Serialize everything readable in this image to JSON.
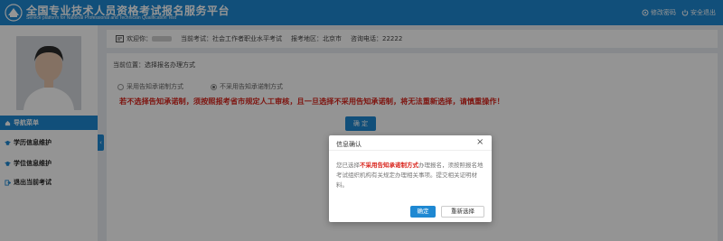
{
  "header": {
    "title": "全国专业技术人员资格考试报名服务平台",
    "subtitle": "Service platform for National Professional and Technician Qualification Test",
    "links": [
      {
        "label": "修改密码",
        "icon": "settings-icon"
      },
      {
        "label": "安全退出",
        "icon": "power-icon"
      }
    ]
  },
  "sidebar": {
    "nav_header": {
      "label": "导航菜单",
      "icon": "home-icon"
    },
    "items": [
      {
        "label": "学历信息维护",
        "icon": "graduation-cap-icon"
      },
      {
        "label": "学位信息维护",
        "icon": "graduation-cap-icon"
      },
      {
        "label": "退出当前考试",
        "icon": "logout-icon"
      }
    ],
    "collapse_glyph": "‹"
  },
  "infobar": {
    "welcome_label": "欢迎你：",
    "current_exam_label": "当前考试：",
    "current_exam_value": "社会工作者职业水平考试",
    "region_label": "报考地区：",
    "region_value": "北京市",
    "phone_label": "咨询电话：",
    "phone_value": "22222"
  },
  "main": {
    "breadcrumb": "当前位置：选择报名办理方式",
    "options": [
      {
        "label": "采用告知承诺制方式",
        "checked": false
      },
      {
        "label": "不采用告知承诺制方式",
        "checked": true
      }
    ],
    "warning": "若不选择告知承诺制，须按照报考省市规定人工审核，且一旦选择不采用告知承诺制，将无法重新选择，请慎重操作！",
    "confirm_label": "确 定"
  },
  "modal": {
    "title": "信息确认",
    "body_prefix": "您已选择",
    "body_highlight": "不采用告知承诺制方式",
    "body_suffix": "办理报名，须按照报名地考试组织机构有关规定办理相关事项。提交相关证明材料。",
    "ok_label": "确定",
    "reselect_label": "重新选择"
  },
  "colors": {
    "primary": "#1e88d2",
    "warning": "#d9251d"
  }
}
